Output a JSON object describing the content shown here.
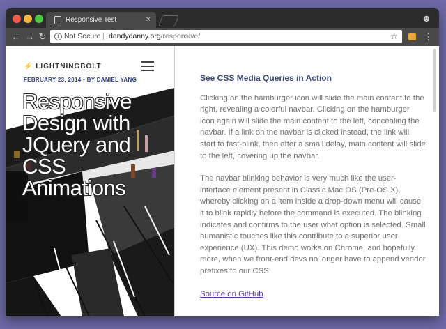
{
  "browser": {
    "tab_title": "Responsive Test",
    "tab_close": "×",
    "url_security_label": "Not Secure",
    "url_separator": "|",
    "url_host": "dandydanny.org",
    "url_path": "/responsive/",
    "icons": [
      "page-icon",
      "close-icon",
      "incognito-icon",
      "back-icon",
      "forward-icon",
      "reload-icon",
      "info-icon",
      "star-icon",
      "extension-icon",
      "menu-icon"
    ]
  },
  "hero": {
    "brand": "⚡ LIGHTNINGBOLT",
    "dateline": "FEBRUARY 23, 2014 • BY DANIEL YANG",
    "title": "Responsive Design with JQuery and CSS Animations",
    "pause_glyph": "❚❚"
  },
  "article": {
    "heading": "See CSS Media Queries in Action",
    "paragraph1": "Clicking on the hamburger icon will slide the main content to the right, revealing a colorful navbar. Clicking on the hamburger icon again will slide the main content to the left, concealing the navbar. If a link on the navbar is clicked instead, the link will start to fast-blink, then after a small delay, main content will slide to the left, covering up the navbar.",
    "paragraph2": "The navbar blinking behavior is very much like the user-interface element present in Classic Mac OS (Pre-OS X), whereby clicking on a item inside a drop-down menu will cause it to blink rapidly before the command is executed. The blinking indicates and confirms to the user what option is selected. Small humanistic touches like this contribute to a superior user experience (UX). This demo works on Chrome, and hopefully more, when we front-end devs no longer have to append vendor prefixes to our CSS.",
    "link_text": "Source on GitHub",
    "link_suffix": "."
  }
}
